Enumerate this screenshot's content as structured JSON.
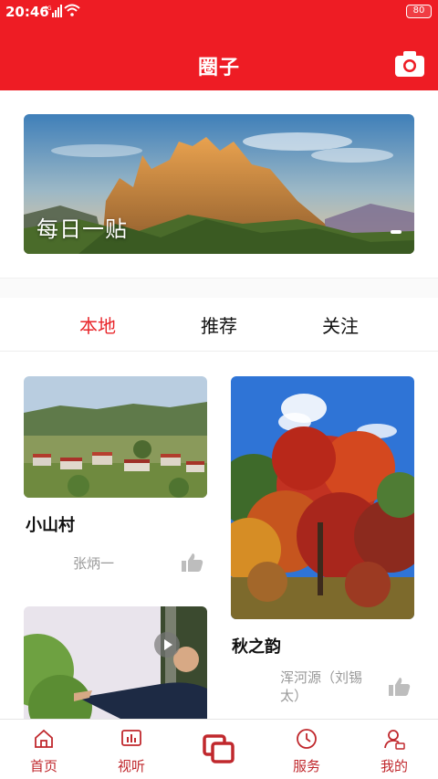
{
  "status": {
    "time": "20:46",
    "network": "4G",
    "battery": "80"
  },
  "header": {
    "title": "圈子"
  },
  "banner": {
    "caption": "每日一贴"
  },
  "tabs": [
    {
      "label": "本地",
      "active": true
    },
    {
      "label": "推荐",
      "active": false
    },
    {
      "label": "关注",
      "active": false
    }
  ],
  "posts": [
    {
      "title": "小山村",
      "author": "张炳一"
    },
    {
      "title": "秋之韵",
      "author": "浑河源（刘锡太）"
    }
  ],
  "nav": [
    {
      "label": "首页",
      "icon": "home-icon"
    },
    {
      "label": "视听",
      "icon": "media-icon"
    },
    {
      "label": "",
      "icon": "circle-posts-icon"
    },
    {
      "label": "服务",
      "icon": "clock-icon"
    },
    {
      "label": "我的",
      "icon": "profile-icon"
    }
  ],
  "colors": {
    "brand": "#ee1c24",
    "tab_active": "#e8262b",
    "nav": "#c0282d"
  }
}
